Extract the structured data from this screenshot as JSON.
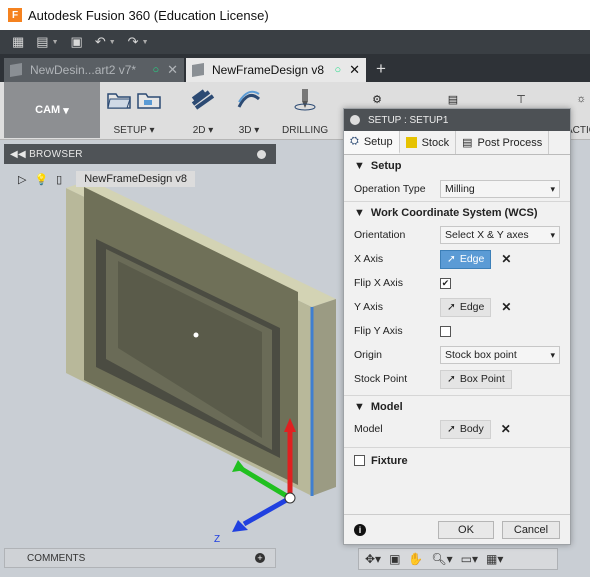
{
  "window": {
    "title": "Autodesk Fusion 360 (Education License)",
    "logo": "F"
  },
  "tabs": [
    {
      "label": "NewDesin...art2 v7*"
    },
    {
      "label": "NewFrameDesign v8"
    }
  ],
  "ribbon": {
    "workspace": "CAM",
    "setup": "SETUP",
    "two_d": "2D",
    "three_d": "3D",
    "drilling": "DRILLING",
    "actions": "ACTIO"
  },
  "browser": {
    "title": "BROWSER",
    "root": "NewFrameDesign v8"
  },
  "comments": {
    "title": "COMMENTS"
  },
  "panel": {
    "title": "SETUP : SETUP1",
    "tabs": [
      "Setup",
      "Stock",
      "Post Process"
    ],
    "setup_section": "Setup",
    "operation_type_label": "Operation Type",
    "operation_type": "Milling",
    "wcs_section": "Work Coordinate System (WCS)",
    "orientation_label": "Orientation",
    "orientation": "Select X & Y axes",
    "x_axis_label": "X Axis",
    "x_axis": "Edge",
    "flip_x_label": "Flip X Axis",
    "y_axis_label": "Y Axis",
    "y_axis": "Edge",
    "flip_y_label": "Flip Y Axis",
    "origin_label": "Origin",
    "origin": "Stock box point",
    "stock_point_label": "Stock Point",
    "stock_point": "Box Point",
    "model_section": "Model",
    "model_label": "Model",
    "model": "Body",
    "fixture_section": "Fixture",
    "ok": "OK",
    "cancel": "Cancel"
  },
  "axis_labels": {
    "z": "Z"
  }
}
